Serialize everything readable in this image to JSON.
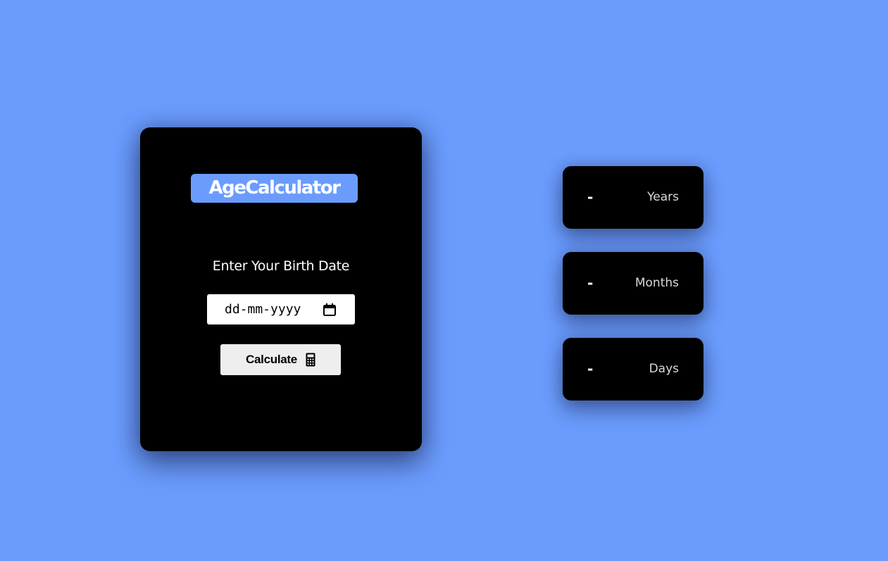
{
  "app": {
    "logo_text": "AgeCalculator",
    "prompt": "Enter Your Birth Date",
    "date_input": {
      "placeholder": "dd-mm-yyyy",
      "icon": "calendar-icon"
    },
    "calculate_button": {
      "label": "Calculate",
      "icon": "calculator-icon"
    }
  },
  "results": [
    {
      "value": "-",
      "unit": "Years"
    },
    {
      "value": "-",
      "unit": "Months"
    },
    {
      "value": "-",
      "unit": "Days"
    }
  ],
  "colors": {
    "background": "#6b9cfd",
    "card": "#000000",
    "accent": "#6b9cfd",
    "button": "#eeeeee"
  }
}
